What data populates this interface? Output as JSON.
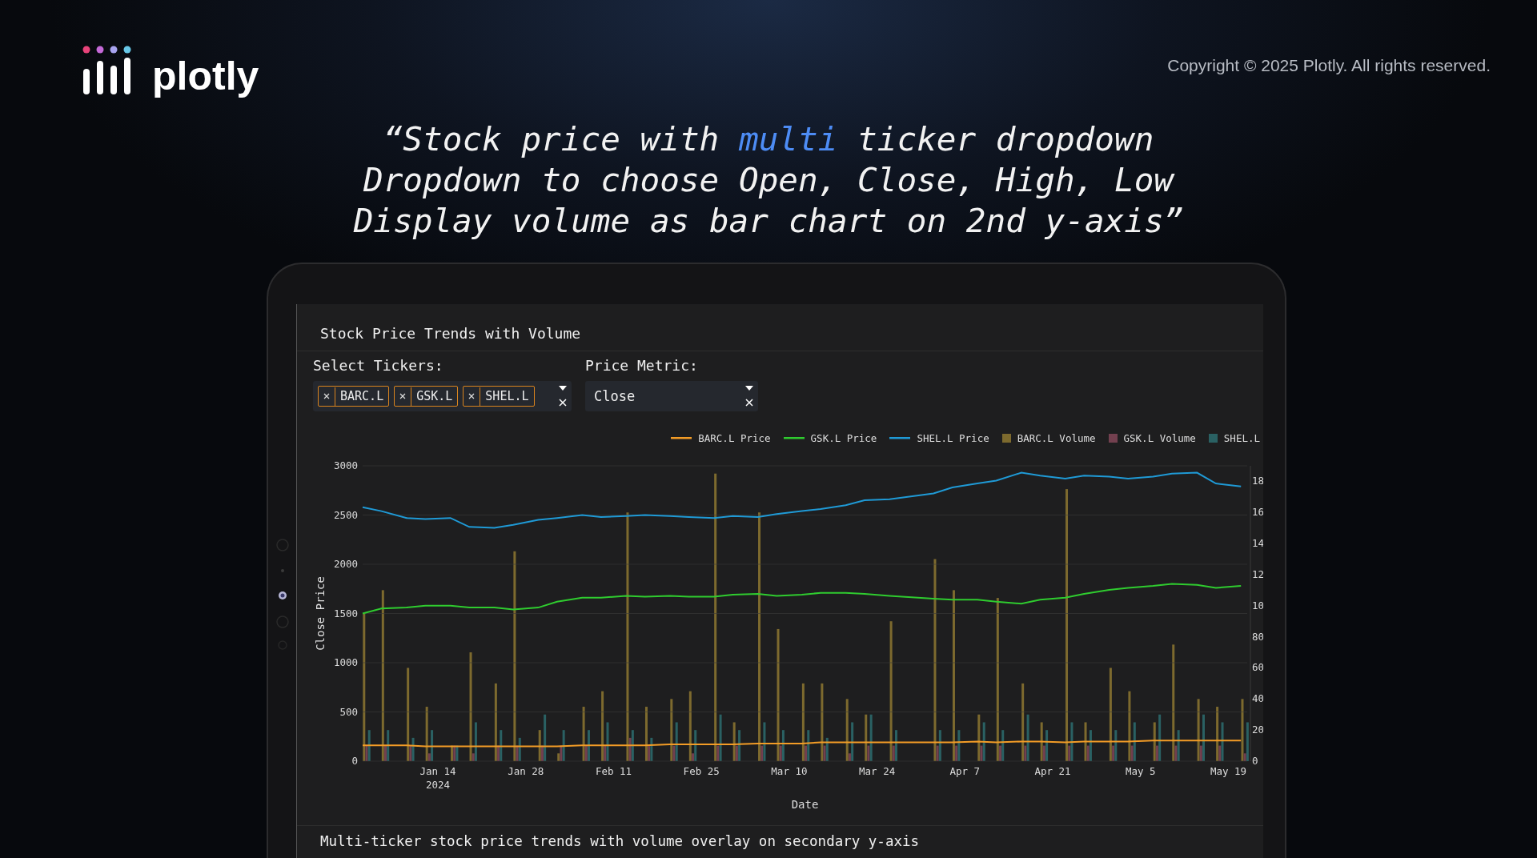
{
  "header": {
    "logo_text": "plotly",
    "copyright": "Copyright © 2025 Plotly. All rights reserved."
  },
  "quote": {
    "lines": [
      {
        "segments": [
          {
            "text": "“Stock price with ",
            "highlight": false
          },
          {
            "text": "multi",
            "highlight": true
          },
          {
            "text": " ticker dropdown",
            "highlight": false
          }
        ]
      },
      {
        "segments": [
          {
            "text": "Dropdown to choose Open, Close, High, Low",
            "highlight": false
          }
        ]
      },
      {
        "segments": [
          {
            "text": "Display volume as bar chart on 2nd y-axis”",
            "highlight": false
          }
        ]
      }
    ]
  },
  "dashboard": {
    "title": "Stock Price Trends with Volume",
    "tickers": {
      "label": "Select Tickers:",
      "chips": [
        "BARC.L",
        "GSK.L",
        "SHEL.L"
      ]
    },
    "metric": {
      "label": "Price Metric:",
      "value": "Close"
    },
    "chart": {
      "year_label": "2024",
      "chart_data": {
        "type": "line",
        "xlabel": "Date",
        "ylabel": "Close Price",
        "grid": true,
        "x": [
          "2024-01-02",
          "2024-01-05",
          "2024-01-09",
          "2024-01-12",
          "2024-01-16",
          "2024-01-19",
          "2024-01-23",
          "2024-01-26",
          "2024-01-30",
          "2024-02-02",
          "2024-02-06",
          "2024-02-09",
          "2024-02-13",
          "2024-02-16",
          "2024-02-20",
          "2024-02-23",
          "2024-02-27",
          "2024-03-01",
          "2024-03-05",
          "2024-03-08",
          "2024-03-12",
          "2024-03-15",
          "2024-03-19",
          "2024-03-22",
          "2024-03-26",
          "2024-04-02",
          "2024-04-05",
          "2024-04-09",
          "2024-04-12",
          "2024-04-16",
          "2024-04-19",
          "2024-04-23",
          "2024-04-26",
          "2024-04-30",
          "2024-05-03",
          "2024-05-07",
          "2024-05-10",
          "2024-05-14",
          "2024-05-17",
          "2024-05-21"
        ],
        "xlim": [
          "2024-01-02",
          "2024-05-22"
        ],
        "ylim": [
          0,
          3000
        ],
        "xticks": [
          {
            "value": "2024-01-14",
            "label": "Jan 14"
          },
          {
            "value": "2024-01-28",
            "label": "Jan 28"
          },
          {
            "value": "2024-02-11",
            "label": "Feb 11"
          },
          {
            "value": "2024-02-25",
            "label": "Feb 25"
          },
          {
            "value": "2024-03-10",
            "label": "Mar 10"
          },
          {
            "value": "2024-03-24",
            "label": "Mar 24"
          },
          {
            "value": "2024-04-07",
            "label": "Apr 7"
          },
          {
            "value": "2024-04-21",
            "label": "Apr 21"
          },
          {
            "value": "2024-05-05",
            "label": "May 5"
          },
          {
            "value": "2024-05-19",
            "label": "May 19"
          }
        ],
        "yticks": [
          0,
          500,
          1000,
          1500,
          2000,
          2500,
          3000
        ],
        "series": [
          {
            "name": "BARC.L Price",
            "color": "#f39c26",
            "values": [
              160,
              160,
              160,
              150,
              150,
              150,
              150,
              150,
              150,
              150,
              160,
              160,
              160,
              160,
              170,
              170,
              170,
              170,
              180,
              180,
              180,
              190,
              190,
              190,
              190,
              190,
              190,
              200,
              190,
              200,
              200,
              190,
              200,
              200,
              200,
              210,
              210,
              210,
              210,
              210
            ]
          },
          {
            "name": "GSK.L Price",
            "color": "#2fcc2f",
            "values": [
              1500,
              1550,
              1560,
              1580,
              1580,
              1560,
              1560,
              1540,
              1560,
              1620,
              1660,
              1660,
              1680,
              1670,
              1680,
              1670,
              1670,
              1690,
              1700,
              1680,
              1690,
              1710,
              1710,
              1700,
              1680,
              1650,
              1640,
              1640,
              1620,
              1600,
              1640,
              1660,
              1700,
              1740,
              1760,
              1780,
              1800,
              1790,
              1760,
              1780
            ]
          },
          {
            "name": "SHEL.L Price",
            "color": "#1f9ad6",
            "values": [
              2580,
              2540,
              2470,
              2460,
              2470,
              2380,
              2370,
              2400,
              2450,
              2470,
              2500,
              2480,
              2490,
              2500,
              2490,
              2480,
              2470,
              2490,
              2480,
              2510,
              2540,
              2560,
              2600,
              2650,
              2660,
              2720,
              2780,
              2820,
              2850,
              2930,
              2900,
              2870,
              2900,
              2890,
              2870,
              2890,
              2920,
              2930,
              2820,
              2790
            ]
          }
        ]
      }
    },
    "volume_chart": {
      "cut_tick_labels": [
        "18",
        "16",
        "14",
        "12",
        "10"
      ],
      "chart_data": {
        "type": "bar",
        "x": [
          "2024-01-02",
          "2024-01-05",
          "2024-01-09",
          "2024-01-12",
          "2024-01-16",
          "2024-01-19",
          "2024-01-23",
          "2024-01-26",
          "2024-01-30",
          "2024-02-02",
          "2024-02-06",
          "2024-02-09",
          "2024-02-13",
          "2024-02-16",
          "2024-02-20",
          "2024-02-23",
          "2024-02-27",
          "2024-03-01",
          "2024-03-05",
          "2024-03-08",
          "2024-03-12",
          "2024-03-15",
          "2024-03-19",
          "2024-03-22",
          "2024-03-26",
          "2024-04-02",
          "2024-04-05",
          "2024-04-09",
          "2024-04-12",
          "2024-04-16",
          "2024-04-19",
          "2024-04-23",
          "2024-04-26",
          "2024-04-30",
          "2024-05-03",
          "2024-05-07",
          "2024-05-10",
          "2024-05-14",
          "2024-05-17",
          "2024-05-21"
        ],
        "xlim": [
          "2024-01-02",
          "2024-05-22"
        ],
        "ylim": [
          0,
          190
        ],
        "yticks": [
          0,
          20,
          40,
          60,
          80
        ],
        "series": [
          {
            "name": "BARC.L Volume",
            "color": "#7d6a2e",
            "values": [
              95,
              110,
              60,
              35,
              10,
              70,
              50,
              135,
              20,
              5,
              35,
              45,
              160,
              35,
              40,
              45,
              185,
              25,
              160,
              85,
              50,
              50,
              40,
              30,
              90,
              130,
              110,
              30,
              105,
              50,
              25,
              175,
              25,
              60,
              45,
              25,
              75,
              40,
              35,
              40
            ]
          },
          {
            "name": "GSK.L Volume",
            "color": "#73404f",
            "values": [
              10,
              10,
              10,
              5,
              10,
              5,
              10,
              10,
              10,
              10,
              10,
              10,
              15,
              10,
              10,
              5,
              10,
              10,
              10,
              10,
              10,
              10,
              5,
              10,
              10,
              10,
              10,
              10,
              10,
              10,
              10,
              10,
              10,
              10,
              10,
              10,
              10,
              10,
              10,
              5
            ]
          },
          {
            "name": "SHEL.L",
            "color": "#2a6163",
            "values": [
              20,
              20,
              15,
              20,
              10,
              25,
              20,
              15,
              30,
              20,
              20,
              25,
              20,
              15,
              25,
              20,
              30,
              20,
              25,
              20,
              20,
              15,
              25,
              30,
              20,
              20,
              20,
              25,
              20,
              30,
              20,
              25,
              20,
              20,
              25,
              30,
              20,
              30,
              25,
              25
            ]
          }
        ]
      }
    },
    "caption": "Multi-ticker stock price trends with volume overlay on secondary y-axis"
  }
}
